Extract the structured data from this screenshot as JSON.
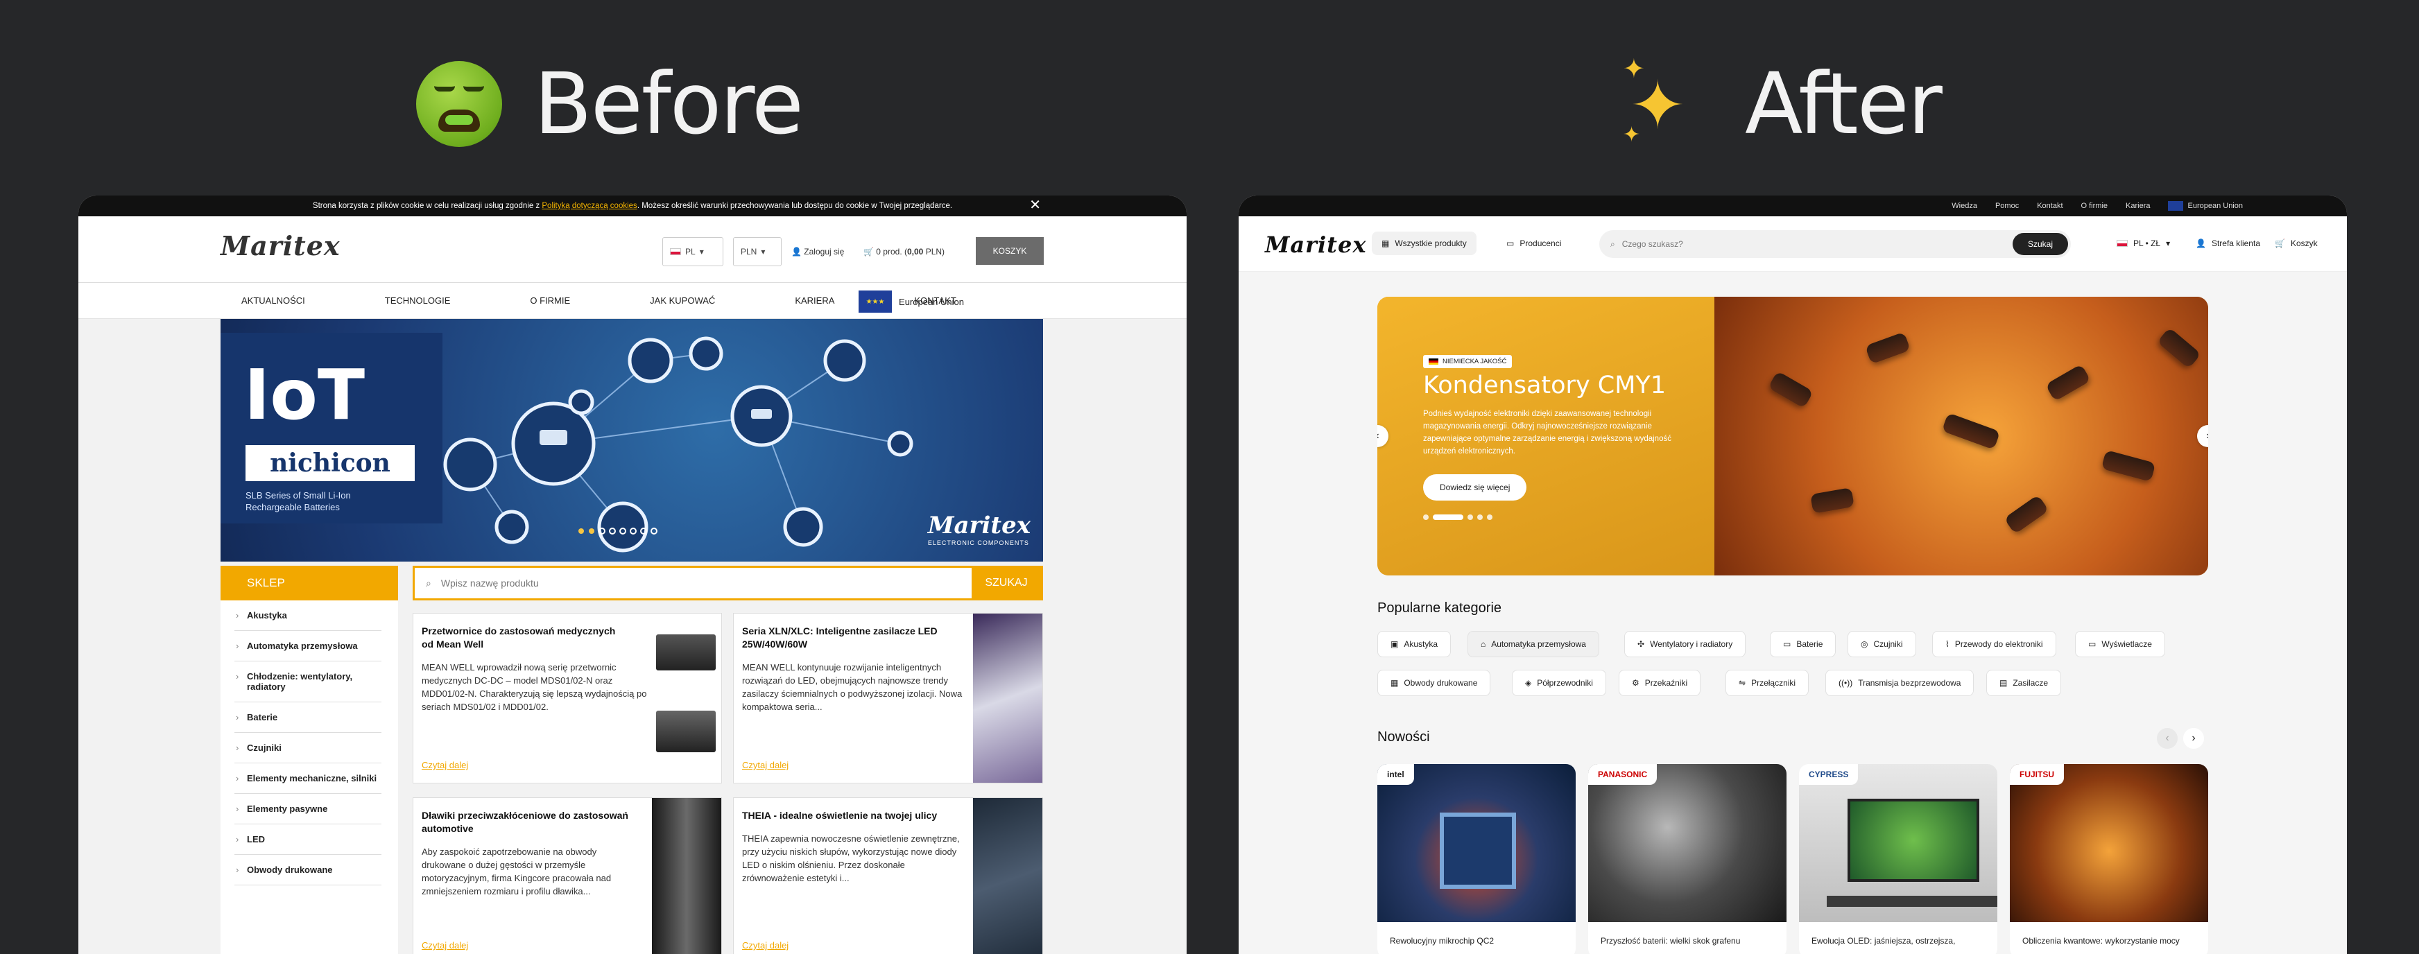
{
  "headers": {
    "before": "Before",
    "after": "After"
  },
  "before": {
    "cookie": {
      "text": "Strona korzysta z plików cookie w celu realizacji usług zgodnie z",
      "link": "Polityką dotyczącą cookies",
      "text2": ". Możesz określić warunki przechowywania lub dostępu do cookie w Twojej przeglądarce.",
      "close": "✕"
    },
    "logo": "Maritex",
    "lang": "PL",
    "currency": "PLN",
    "login": "Zaloguj się",
    "cart_prefix": "0 prod. (",
    "cart_amount": "0,00",
    "cart_suffix": " PLN)",
    "cart_button": "KOSZYK",
    "nav": [
      "AKTUALNOŚCI",
      "TECHNOLOGIE",
      "O FIRMIE",
      "JAK KUPOWAĆ",
      "KARIERA",
      "KONTAKT"
    ],
    "eu_label": "European Union",
    "banner": {
      "big": "IoT",
      "brand": "nichicon",
      "line1": "SLB Series of Small Li-Ion",
      "line2": "Rechargeable Batteries",
      "wm": "Maritex",
      "wm_sub": "ELECTRONIC COMPONENTS"
    },
    "shop_label": "SKLEP",
    "sidebar": [
      "Akustyka",
      "Automatyka przemysłowa",
      "Chłodzenie: wentylatory, radiatory",
      "Baterie",
      "Czujniki",
      "Elementy mechaniczne, silniki",
      "Elementy pasywne",
      "LED",
      "Obwody drukowane"
    ],
    "search": {
      "placeholder": "Wpisz nazwę produktu",
      "button": "SZUKAJ"
    },
    "articles": [
      {
        "title": "Przetwornice do zastosowań medycznych od Mean Well",
        "body": "MEAN WELL wprowadził nową serię przetwornic medycznych DC-DC – model MDS01/02-N oraz MDD01/02-N. Charakteryzują się lepszą wydajnością po seriach MDS01/02 i MDD01/02.",
        "more": "Czytaj dalej"
      },
      {
        "title": "Seria XLN/XLC: Inteligentne zasilacze LED 25W/40W/60W",
        "body": "MEAN WELL kontynuuje rozwijanie inteligentnych rozwiązań do LED, obejmujących najnowsze trendy zasilaczy ściemnialnych o podwyższonej izolacji. Nowa kompaktowa seria...",
        "more": "Czytaj dalej"
      },
      {
        "title": "Dławiki przeciwzakłóceniowe do zastosowań automotive",
        "body": "Aby zaspokoić zapotrzebowanie na obwody drukowane o dużej gęstości w przemyśle motoryzacyjnym, firma Kingcore pracowała nad zmniejszeniem rozmiaru i profilu dławika...",
        "more": "Czytaj dalej"
      },
      {
        "title": "THEIA - idealne oświetlenie na twojej ulicy",
        "body": "THEIA zapewnia nowoczesne oświetlenie zewnętrzne, przy użyciu niskich słupów, wykorzystując nowe diody LED o niskim olśnieniu. Przez doskonałe zrównoważenie estetyki i...",
        "more": "Czytaj dalej"
      }
    ]
  },
  "after": {
    "topbar": [
      "Wiedza",
      "Pomoc",
      "Kontakt",
      "O firmie",
      "Kariera"
    ],
    "eu_label": "European Union",
    "logo": "Maritex",
    "all_products": "Wszystkie produkty",
    "producers": "Producenci",
    "search": {
      "placeholder": "Czego szukasz?",
      "button": "Szukaj"
    },
    "locale": "PL • ZŁ",
    "client_zone": "Strefa klienta",
    "cart": "Koszyk",
    "hero": {
      "tag": "NIEMIECKA JAKOŚĆ",
      "title": "Kondensatory CMY1",
      "body": "Podnieś wydajność elektroniki dzięki zaawansowanej technologii magazynowania energii. Odkryj najnowocześniejsze rozwiązanie zapewniające optymalne zarządzanie energią i zwiększoną wydajność urządzeń elektronicznych.",
      "button": "Dowiedz się więcej",
      "prev": "‹",
      "next": "›"
    },
    "categories_title": "Popularne kategorie",
    "categories": [
      "Akustyka",
      "Automatyka przemysłowa",
      "Wentylatory i radiatory",
      "Baterie",
      "Czujniki",
      "Przewody do elektroniki",
      "Wyświetlacze",
      "Obwody drukowane",
      "Półprzewodniki",
      "Przekaźniki",
      "Przełączniki",
      "Transmisja bezprzewodowa",
      "Zasilacze"
    ],
    "news_title": "Nowości",
    "news": [
      {
        "brand": "intel",
        "title": "Rewolucyjny mikrochip QC2"
      },
      {
        "brand": "PANASONIC",
        "title": "Przyszłość baterii: wielki skok grafenu"
      },
      {
        "brand": "CYPRESS",
        "title": "Ewolucja OLED: jaśniejsza, ostrzejsza,"
      },
      {
        "brand": "FUJITSU",
        "title": "Obliczenia kwantowe: wykorzystanie mocy"
      }
    ]
  },
  "colors": {
    "accent_before": "#f2a800",
    "accent_after": "#f3b52c",
    "bg": "#262729"
  }
}
